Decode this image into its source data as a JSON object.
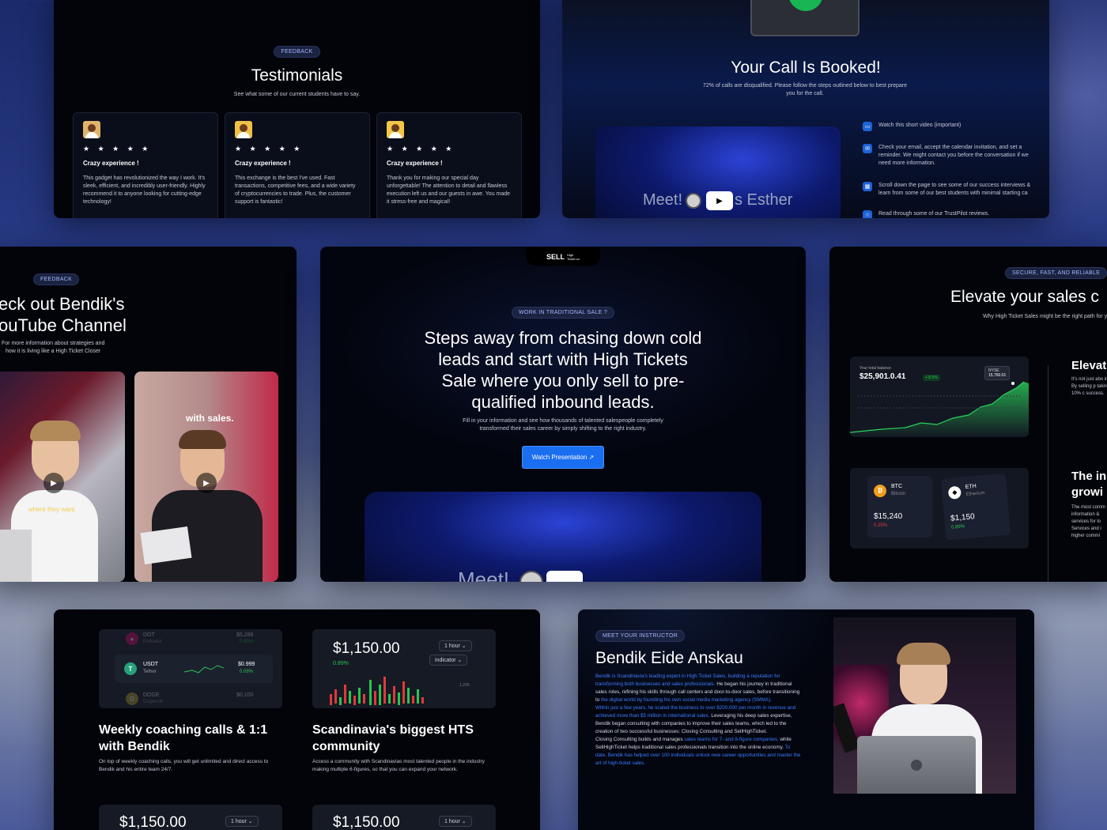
{
  "testimonials": {
    "pill": "FEEDBACK",
    "title": "Testimonials",
    "subtitle": "See what some of our current students have to say.",
    "cards": [
      {
        "heading": "Crazy experience !",
        "stars": "★ ★ ★ ★ ★",
        "text": "This gadget has revolutionized the way I work. It's sleek, efficient, and incredibly user-friendly. Highly recommend it to anyone looking for cutting-edge technology!"
      },
      {
        "heading": "Crazy experience !",
        "stars": "★ ★ ★ ★ ★",
        "text": "This exchange is the best I've used. Fast transactions, competitive fees, and a wide variety of cryptocurrencies to trade. Plus, the customer support is fantastic!"
      },
      {
        "heading": "Crazy experience !",
        "stars": "★ ★ ★ ★ ★",
        "text": "Thank you for making our special day unforgettable! The attention to detail and flawless execution left us and our guests in awe. You made it stress-free and magical!"
      }
    ]
  },
  "booked": {
    "title": "Your Call Is Booked!",
    "subtitle": "72% of calls are disqualified. Please follow the steps outlined below to best prepare you for the call.",
    "video_text_left": "Meet!",
    "video_text_right": "s Esther",
    "steps": [
      "Watch this short video (important)",
      "Check your email, accept the calendar invitation, and set a reminder. We might contact you before the conversation if we need more information.",
      "Scroll down the page to see some of our success interviews & learn from some of our best students with minimal starting ca",
      "Read through some of our TrustPilot reviews."
    ]
  },
  "youtube": {
    "pill": "FEEDBACK",
    "title_line1": "eck out Bendik's",
    "title_line2": "ouTube Channel",
    "subtitle_line1": "For more information about strategies and",
    "subtitle_line2": "how it is living like a High Ticket Closer",
    "caption1": "where they want",
    "caption2": "with sales."
  },
  "hero": {
    "logo": "SELL",
    "logo_sub": "High Ticket.co",
    "pill": "WORK IN TRADITIONAL SALE ?",
    "headline_line1": "Steps away from chasing down cold",
    "headline_line2": "leads and start with High Tickets",
    "headline_line3": "Sale where you only sell to pre-",
    "headline_line4": "qualified inbound leads.",
    "sub_line1": "Fill in your information and see how thousands of talented salespeople completely",
    "sub_line2": "transformed their sales career by simply shifting to the right industry.",
    "cta": "Watch Presentation ↗",
    "video_text": "Meet!"
  },
  "elevate": {
    "pill": "SECURE, FAST, AND RELIABLE",
    "title": "Elevate your sales c",
    "subtitle": "Why High Ticket Sales might be the right path for y",
    "balance_label": "Your total balance",
    "balance": "$25,901.0.41",
    "balance_change": "+ 8.5%",
    "nyse_label": "NYSE",
    "nyse_value": "15,760.01",
    "btc": {
      "symbol": "BTC",
      "name": "Bitcoin",
      "price": "$15,240",
      "change": "0.25%"
    },
    "eth": {
      "symbol": "ETH",
      "name": "Etherium",
      "price": "$1,150",
      "change": "0.89%"
    },
    "side_title1": "Elevat",
    "side_text1": "It's not just abo in. By selling p taking a 10% c success.",
    "side_title2a": "The in",
    "side_title2b": "growi",
    "side_text2": "The most comm information & services for lo Services and i higher commi"
  },
  "features": {
    "list": [
      {
        "symbol": "DOT",
        "name": "Polkadot",
        "price": "$5,288",
        "change": "0.89%"
      },
      {
        "symbol": "USDT",
        "name": "Tether",
        "price": "$0.999",
        "change": "0.09%"
      },
      {
        "symbol": "DOGE",
        "name": "Dogecoin",
        "price": "$0.100",
        "change": ""
      }
    ],
    "price_big": "$1,150.00",
    "price_change": "0.89%",
    "select_hour": "1 hour ⌄",
    "select_indicator": "indicator ⌄",
    "axis_label": "1,200",
    "title1_line1": "Weekly coaching calls & 1:1",
    "title1_line2": "with Bendik",
    "text1": "On top of weekly coaching calls, you will get unlimited and direct access to Bendik and his entire team 24/7.",
    "title2_line1": "Scandinavia's biggest HTS",
    "title2_line2": "community",
    "text2": "Access a community with Scandinavias most talented people in the industry making multiple 6-figures, so that you can expand your network.",
    "bottom_price1": "$1,150.00",
    "bottom_price2": "$1,150.00",
    "bottom_select": "1 hour ⌄"
  },
  "instructor": {
    "pill": "MEET YOUR INSTRUCTOR",
    "name": "Bendik Eide Anskau",
    "p1_a": "Bendik is Scandinavia's leading expert in High Ticket Sales, building a reputation for transforming both businesses and sales professionals.",
    "p1_b": "He began his journey in traditional sales roles, refining his skills through call centers and door-to-door sales, before transitioning to",
    "p1_c": "the digital world by founding his own social media marketing agency (SMMA).",
    "p2_a": "Within just a few years, he scaled the business to over $200,000 per month in revenue and achieved more than $5 million in international sales.",
    "p2_b": "Leveraging his deep sales expertise, Bendik began consulting with companies to improve their sales teams, which led to the creation of two successful businesses: Closing Consulting and SellHighTicket.",
    "p3_a": "Closing Consulting builds and manages",
    "p3_b": "sales teams for 7- and 8-figure companies,",
    "p3_c": "while SellHighTicket helps traditional sales professionals transition into the online economy.",
    "p3_d": "To date, Bendik has helped over 100 individuals unlock new career opportunities and master the art of high-ticket sales."
  }
}
